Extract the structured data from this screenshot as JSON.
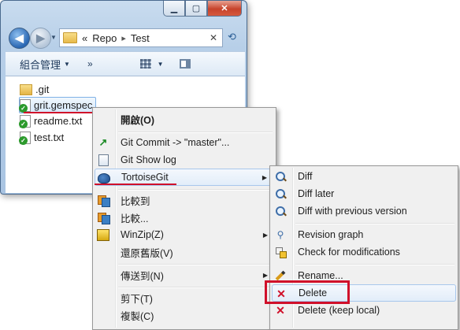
{
  "explorer": {
    "address_overflow": "«",
    "address_parts": [
      "Repo",
      "Test"
    ],
    "address_sep": "▸",
    "toolbar": {
      "organize": "組合管理",
      "more": "»"
    },
    "files": [
      {
        "name": ".git",
        "type": "folder"
      },
      {
        "name": "grit.gemspec",
        "type": "file",
        "selected": true
      },
      {
        "name": "readme.txt",
        "type": "file"
      },
      {
        "name": "test.txt",
        "type": "file"
      }
    ]
  },
  "context_menu": {
    "items": [
      {
        "label": "開啟(O)",
        "bold": true
      },
      {
        "label": "Git Commit -> \"master\"..."
      },
      {
        "label": "Git Show log"
      },
      {
        "label": "TortoiseGit",
        "submenu": true
      },
      {
        "label": "比較到"
      },
      {
        "label": "比較..."
      },
      {
        "label": "WinZip(Z)",
        "submenu": true
      },
      {
        "label": "還原舊版(V)"
      },
      {
        "label": "傳送到(N)",
        "submenu": true
      },
      {
        "label": "剪下(T)"
      },
      {
        "label": "複製(C)"
      }
    ]
  },
  "tortoisegit_submenu": {
    "items": [
      {
        "label": "Diff"
      },
      {
        "label": "Diff later"
      },
      {
        "label": "Diff with previous version"
      },
      {
        "label": "Revision graph"
      },
      {
        "label": "Check for modifications"
      },
      {
        "label": "Rename..."
      },
      {
        "label": "Delete",
        "highlighted": true
      },
      {
        "label": "Delete (keep local)"
      }
    ]
  },
  "colors": {
    "annotation_red": "#d0102a",
    "highlight": "#e2edf9"
  }
}
